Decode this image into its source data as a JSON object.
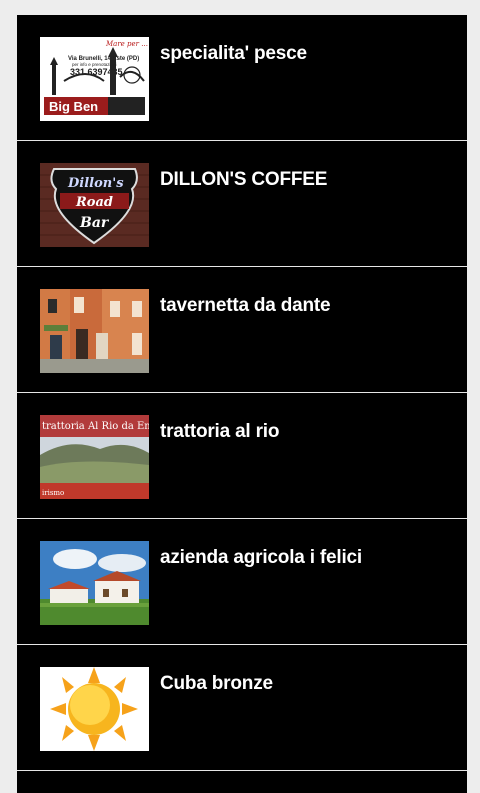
{
  "items": [
    {
      "title": "specialita' pesce",
      "thumb_icon": "big-ben-logo"
    },
    {
      "title": "DILLON'S COFFEE",
      "thumb_icon": "dillons-road-bar-logo"
    },
    {
      "title": "tavernetta da dante",
      "thumb_icon": "building-photo"
    },
    {
      "title": "trattoria al rio",
      "thumb_icon": "landscape-photo"
    },
    {
      "title": "azienda agricola i felici",
      "thumb_icon": "farmhouse-photo"
    },
    {
      "title": "Cuba bronze",
      "thumb_icon": "sun-icon"
    }
  ],
  "logos": {
    "big_ben": {
      "script": "Mare per ...",
      "address": "Via Brunelli, 14 Este (PD)",
      "note": "per info e prenotazioni",
      "phone": "331 6397435",
      "name": "Big Ben"
    },
    "dillons": {
      "line1": "Dillon's",
      "line2": "Road",
      "line3": "Bar"
    },
    "rio": {
      "banner": "trattoria Al Rio da Emil",
      "footer": "irismo"
    }
  },
  "colors": {
    "page_bg": "#ededed",
    "list_bg": "#000000",
    "divider": "#e6e6e6",
    "title": "#ffffff"
  }
}
